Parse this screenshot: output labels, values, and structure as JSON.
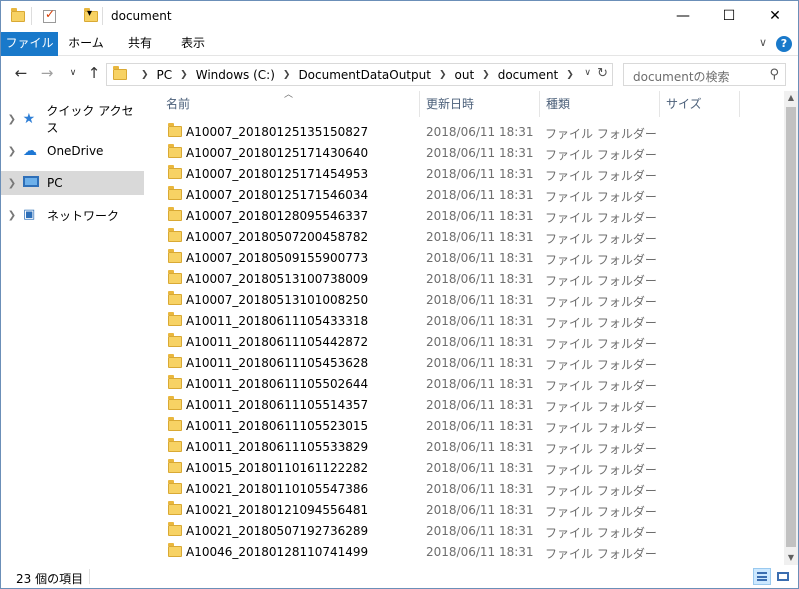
{
  "window": {
    "title": "document",
    "controls": {
      "minimize": "—",
      "maximize": "☐",
      "close": "✕"
    }
  },
  "ribbon": {
    "tabs": [
      {
        "label": "ファイル"
      },
      {
        "label": "ホーム"
      },
      {
        "label": "共有"
      },
      {
        "label": "表示"
      }
    ],
    "expand_glyph": "∨",
    "help_glyph": "?"
  },
  "address": {
    "crumbs": [
      "PC",
      "Windows (C:)",
      "DocumentDataOutput",
      "out",
      "document"
    ],
    "search_placeholder": "documentの検索"
  },
  "nav_pane": {
    "items": [
      {
        "label": "クイック アクセス",
        "icon": "star-icon",
        "selected": false
      },
      {
        "label": "OneDrive",
        "icon": "cloud-icon",
        "selected": false
      },
      {
        "label": "PC",
        "icon": "computer-icon",
        "selected": true
      },
      {
        "label": "ネットワーク",
        "icon": "network-icon",
        "selected": false
      }
    ]
  },
  "columns": {
    "name": "名前",
    "date": "更新日時",
    "type": "種類",
    "size": "サイズ"
  },
  "files": [
    {
      "name": "A10007_20180125135150827",
      "date": "2018/06/11 18:31",
      "type": "ファイル フォルダー"
    },
    {
      "name": "A10007_20180125171430640",
      "date": "2018/06/11 18:31",
      "type": "ファイル フォルダー"
    },
    {
      "name": "A10007_20180125171454953",
      "date": "2018/06/11 18:31",
      "type": "ファイル フォルダー"
    },
    {
      "name": "A10007_20180125171546034",
      "date": "2018/06/11 18:31",
      "type": "ファイル フォルダー"
    },
    {
      "name": "A10007_20180128095546337",
      "date": "2018/06/11 18:31",
      "type": "ファイル フォルダー"
    },
    {
      "name": "A10007_20180507200458782",
      "date": "2018/06/11 18:31",
      "type": "ファイル フォルダー"
    },
    {
      "name": "A10007_20180509155900773",
      "date": "2018/06/11 18:31",
      "type": "ファイル フォルダー"
    },
    {
      "name": "A10007_20180513100738009",
      "date": "2018/06/11 18:31",
      "type": "ファイル フォルダー"
    },
    {
      "name": "A10007_20180513101008250",
      "date": "2018/06/11 18:31",
      "type": "ファイル フォルダー"
    },
    {
      "name": "A10011_20180611105433318",
      "date": "2018/06/11 18:31",
      "type": "ファイル フォルダー"
    },
    {
      "name": "A10011_20180611105442872",
      "date": "2018/06/11 18:31",
      "type": "ファイル フォルダー"
    },
    {
      "name": "A10011_20180611105453628",
      "date": "2018/06/11 18:31",
      "type": "ファイル フォルダー"
    },
    {
      "name": "A10011_20180611105502644",
      "date": "2018/06/11 18:31",
      "type": "ファイル フォルダー"
    },
    {
      "name": "A10011_20180611105514357",
      "date": "2018/06/11 18:31",
      "type": "ファイル フォルダー"
    },
    {
      "name": "A10011_20180611105523015",
      "date": "2018/06/11 18:31",
      "type": "ファイル フォルダー"
    },
    {
      "name": "A10011_20180611105533829",
      "date": "2018/06/11 18:31",
      "type": "ファイル フォルダー"
    },
    {
      "name": "A10015_20180110161122282",
      "date": "2018/06/11 18:31",
      "type": "ファイル フォルダー"
    },
    {
      "name": "A10021_20180110105547386",
      "date": "2018/06/11 18:31",
      "type": "ファイル フォルダー"
    },
    {
      "name": "A10021_20180121094556481",
      "date": "2018/06/11 18:31",
      "type": "ファイル フォルダー"
    },
    {
      "name": "A10021_20180507192736289",
      "date": "2018/06/11 18:31",
      "type": "ファイル フォルダー"
    },
    {
      "name": "A10046_20180128110741499",
      "date": "2018/06/11 18:31",
      "type": "ファイル フォルダー"
    }
  ],
  "status": {
    "item_count": "23 個の項目"
  },
  "colors": {
    "accent": "#1979ca",
    "folder": "#f7d264",
    "selection": "#d9d9d9"
  }
}
